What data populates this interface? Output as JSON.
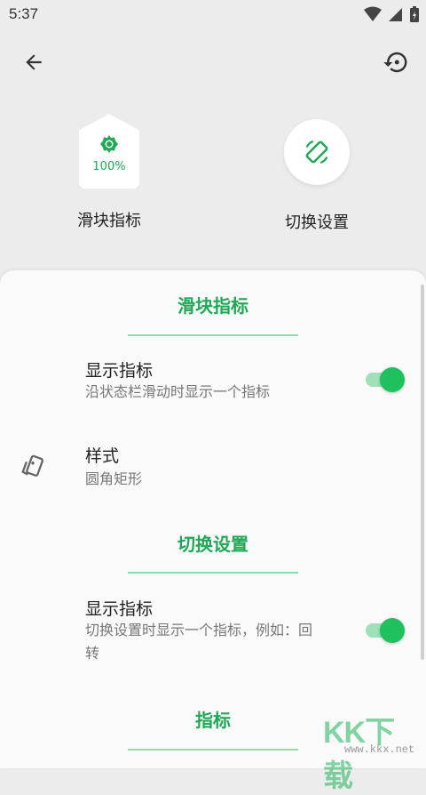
{
  "status_bar": {
    "time": "5:37"
  },
  "colors": {
    "accent": "#1fa855",
    "switch_on": "#1fc15f",
    "background": "#ececec",
    "sheet": "#fafafa"
  },
  "toolbar": {
    "back_icon": "arrow-left-icon",
    "reset_icon": "restore-icon"
  },
  "previews": [
    {
      "label": "滑块指标",
      "value": "100%",
      "icon": "brightness-icon"
    },
    {
      "label": "切换设置",
      "icon": "screen-rotation-icon"
    }
  ],
  "sections": [
    {
      "title": "滑块指标",
      "rows": [
        {
          "title": "显示指标",
          "subtitle": "沿状态栏滑动时显示一个指标",
          "switch_on": true
        },
        {
          "title": "样式",
          "subtitle": "圆角矩形",
          "icon": "style-icon"
        }
      ]
    },
    {
      "title": "切换设置",
      "rows": [
        {
          "title": "显示指标",
          "subtitle": "切换设置时显示一个指标，例如：回转",
          "switch_on": true
        }
      ]
    },
    {
      "title": "指标"
    }
  ],
  "watermark": {
    "text": "KK下载",
    "url": "www.kkx.net"
  }
}
